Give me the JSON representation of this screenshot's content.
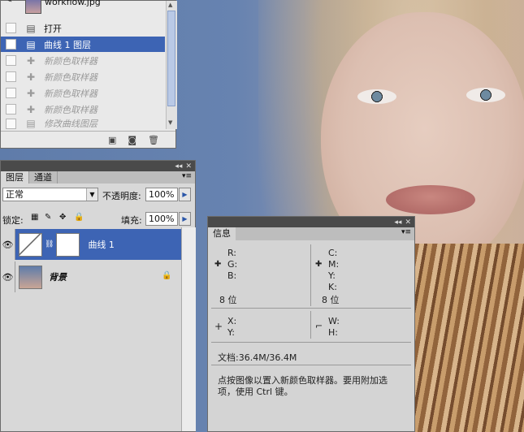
{
  "history": {
    "snapshot_label": "workflow.jpg",
    "items": [
      {
        "label": "打开",
        "state": "normal"
      },
      {
        "label": "曲线 1 图层",
        "state": "selected"
      },
      {
        "label": "新颜色取样器",
        "state": "dim"
      },
      {
        "label": "新颜色取样器",
        "state": "dim"
      },
      {
        "label": "新颜色取样器",
        "state": "dim"
      },
      {
        "label": "新颜色取样器",
        "state": "dim"
      },
      {
        "label": "修改曲线图层",
        "state": "dim"
      }
    ]
  },
  "layers": {
    "tabs": [
      "图层",
      "通道"
    ],
    "blend_mode": "正常",
    "opacity_label": "不透明度:",
    "opacity_value": "100%",
    "lock_label": "锁定:",
    "fill_label": "填充:",
    "fill_value": "100%",
    "items": [
      {
        "name": "曲线 1",
        "selected": true
      },
      {
        "name": "背景",
        "selected": false
      }
    ]
  },
  "info": {
    "tab": "信息",
    "r": "R:",
    "g": "G:",
    "b": "B:",
    "c": "C:",
    "m": "M:",
    "y": "Y:",
    "k": "K:",
    "bit_left": "8 位",
    "bit_right": "8 位",
    "x": "X:",
    "yy": "Y:",
    "w": "W:",
    "h": "H:",
    "doc": "文档:36.4M/36.4M",
    "hint_line1": "点按图像以置入新颜色取样器。要用附加选",
    "hint_line2": "项，使用 Ctrl 键。"
  },
  "colors": {
    "selection": "#3d64b4",
    "panel": "#d6d6d6",
    "background": "#5d7aa8"
  }
}
